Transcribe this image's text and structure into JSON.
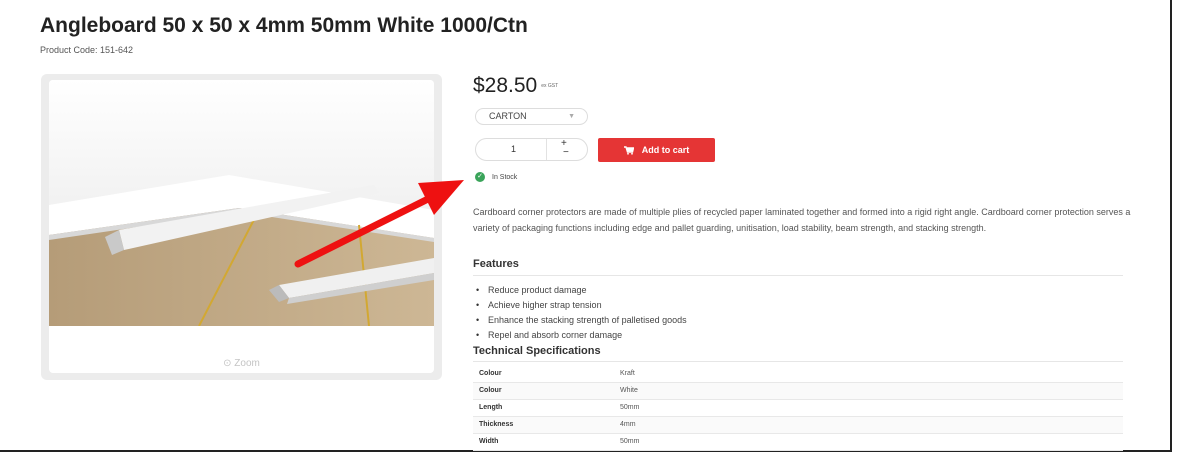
{
  "product": {
    "title": "Angleboard 50 x 50 x 4mm 50mm White 1000/Ctn",
    "code": "Product Code: 151-642"
  },
  "gallery": {
    "zoom_label": "Zoom",
    "zoom_icon": "search-icon"
  },
  "pricing": {
    "price": "$28.50",
    "gst": "ex GST"
  },
  "unit_select": {
    "value": "CARTON"
  },
  "quantity": {
    "value": "1",
    "plus": "+",
    "minus": "−"
  },
  "cart": {
    "label": "Add to cart",
    "icon": "cart-icon",
    "color": "#e53535"
  },
  "stock": {
    "label": "In Stock",
    "color": "#3aa45a"
  },
  "description": "Cardboard corner protectors are made of multiple plies of recycled paper laminated together and formed into a rigid right angle. Cardboard corner protection serves a variety of packaging functions including edge and pallet guarding, unitisation, load stability, beam strength, and stacking strength.",
  "features": {
    "heading": "Features",
    "items": [
      "Reduce product damage",
      "Achieve higher strap tension",
      "Enhance the stacking strength of palletised goods",
      "Repel and absorb corner damage"
    ]
  },
  "specs": {
    "heading": "Technical Specifications",
    "rows": [
      {
        "key": "Colour",
        "value": "Kraft"
      },
      {
        "key": "Colour",
        "value": "White"
      },
      {
        "key": "Length",
        "value": "50mm"
      },
      {
        "key": "Thickness",
        "value": "4mm"
      },
      {
        "key": "Width",
        "value": "50mm"
      }
    ]
  },
  "annotation": {
    "color": "#ee1111"
  }
}
